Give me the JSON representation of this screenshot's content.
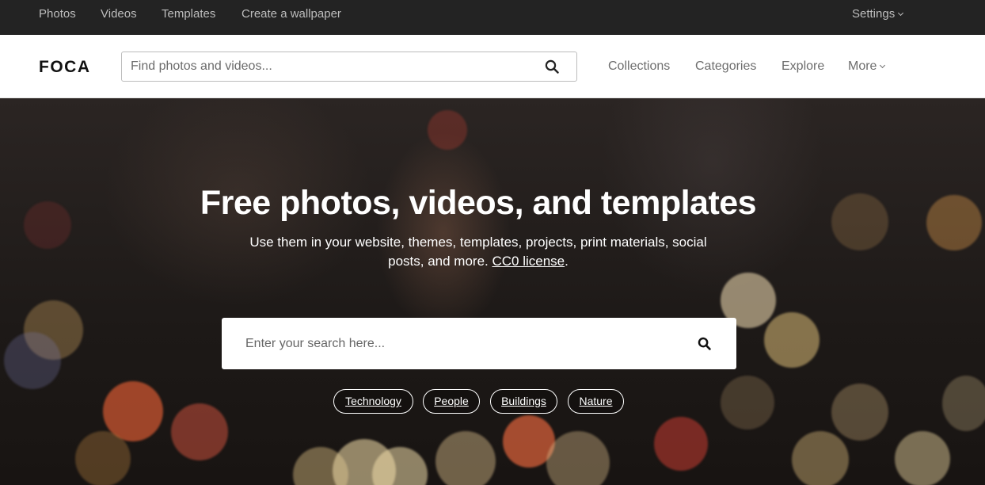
{
  "topbar": {
    "links": [
      "Photos",
      "Videos",
      "Templates",
      "Create a wallpaper"
    ],
    "settings_label": "Settings"
  },
  "header": {
    "logo": "FOCA",
    "search_placeholder": "Find photos and videos...",
    "nav": [
      "Collections",
      "Categories",
      "Explore"
    ],
    "more_label": "More"
  },
  "hero": {
    "title": "Free photos, videos, and templates",
    "subtitle": "Use them in your website, themes, templates, projects, print materials, social posts, and more.",
    "license_link": "CC0 license",
    "subtitle_end": ".",
    "search_placeholder": "Enter your search here...",
    "chips": [
      "Technology",
      "People",
      "Buildings",
      "Nature"
    ]
  },
  "colors": {
    "topbar_bg": "#232323",
    "header_bg": "#ffffff",
    "hero_text": "#ffffff"
  },
  "icons": {
    "search": "search-icon",
    "dropdown": "chevron-down-icon"
  }
}
